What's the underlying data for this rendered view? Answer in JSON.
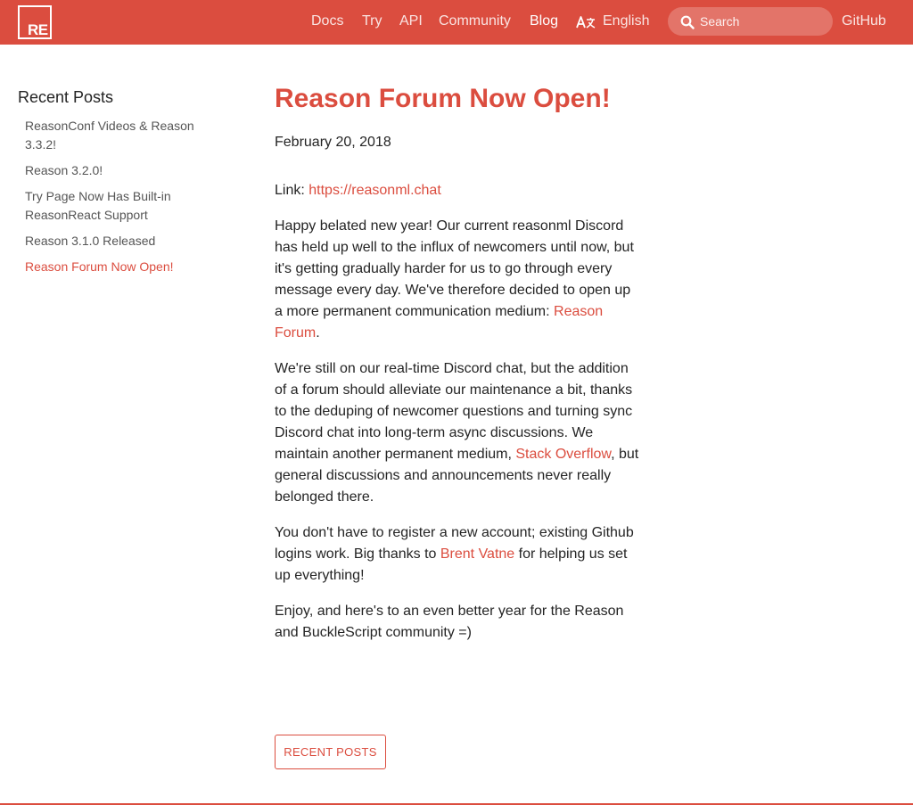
{
  "header": {
    "logo_text": "RE",
    "nav": [
      {
        "label": "Docs",
        "active": false
      },
      {
        "label": "Try",
        "active": false
      },
      {
        "label": "API",
        "active": false
      },
      {
        "label": "Community",
        "active": false
      },
      {
        "label": "Blog",
        "active": true
      }
    ],
    "language": "English",
    "search_placeholder": "Search",
    "github": "GitHub"
  },
  "sidebar": {
    "heading": "Recent Posts",
    "items": [
      {
        "label": "ReasonConf Videos & Reason 3.3.2!",
        "active": false
      },
      {
        "label": "Reason 3.2.0!",
        "active": false
      },
      {
        "label": "Try Page Now Has Built-in ReasonReact Support",
        "active": false
      },
      {
        "label": "Reason 3.1.0 Released",
        "active": false
      },
      {
        "label": "Reason Forum Now Open!",
        "active": true
      }
    ]
  },
  "post": {
    "title": "Reason Forum Now Open!",
    "date": "February 20, 2018",
    "p1_prefix": "Link: ",
    "p1_link": "https://reasonml.chat",
    "p2_text": "Happy belated new year! Our current reasonml Discord has held up well to the influx of newcomers until now, but it's getting gradually harder for us to go through every message every day. We've therefore decided to open up a more permanent communication medium: ",
    "p2_link": "Reason Forum",
    "p2_end": ".",
    "p3_text": "We're still on our real-time Discord chat, but the addition of a forum should alleviate our maintenance a bit, thanks to the deduping of newcomer questions and turning sync Discord chat into long-term async discussions. We maintain another permanent medium, ",
    "p3_link": "Stack Overflow",
    "p3_end": ", but general discussions and announcements never really belonged there.",
    "p4_text": "You don't have to register a new account; existing Github logins work. Big thanks to ",
    "p4_link": "Brent Vatne",
    "p4_end": " for helping us set up everything!",
    "p5_text": "Enjoy, and here's to an even better year for the Reason and BuckleScript community =)"
  },
  "footer": {
    "recent_button": "RECENT POSTS"
  },
  "colors": {
    "brand": "#db4d3f",
    "text": "#242424",
    "muted": "#555555"
  }
}
